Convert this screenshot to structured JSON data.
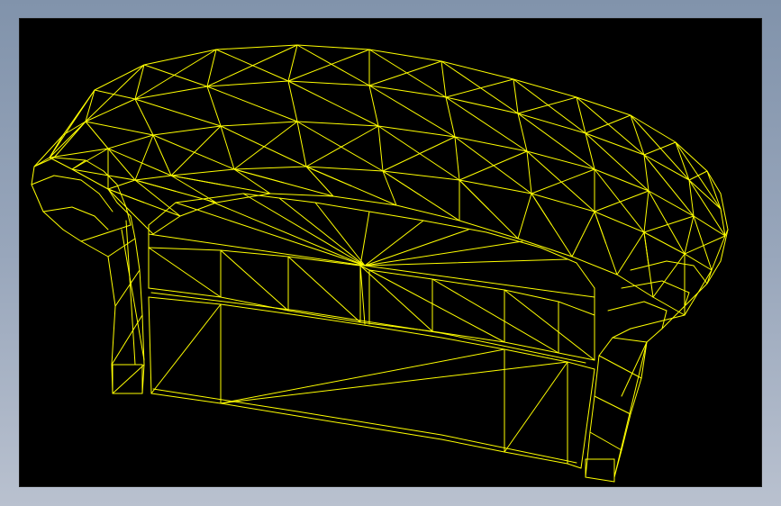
{
  "viewport": {
    "background": "#000000",
    "wire_color": "#ffff00",
    "render_mode": "wireframe",
    "subject": "sofa"
  }
}
